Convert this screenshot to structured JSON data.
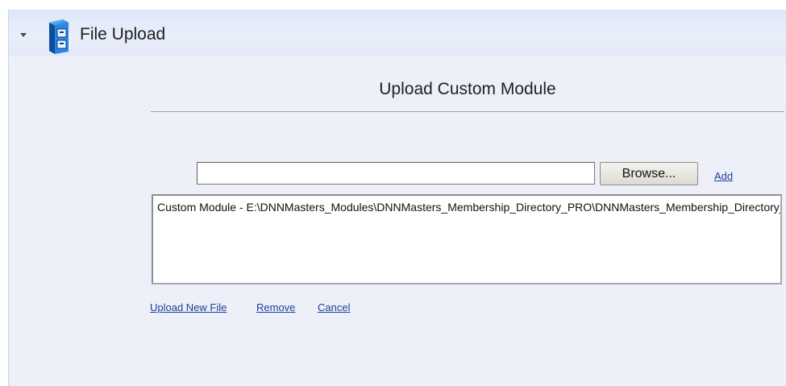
{
  "module": {
    "title": "File Upload",
    "icon": "file-cabinet-icon",
    "collapse_icon": "collapse-arrow-icon"
  },
  "page": {
    "heading": "Upload Custom Module"
  },
  "upload_form": {
    "file_input_value": "",
    "browse_label": "Browse...",
    "add_label": "Add"
  },
  "file_list": {
    "items": [
      "Custom Module - E:\\DNNMasters_Modules\\DNNMasters_Membership_Directory_PRO\\DNNMasters_Membership_Directory_PRO"
    ]
  },
  "actions": {
    "upload_new_file": "Upload New File",
    "remove": "Remove",
    "cancel": "Cancel"
  },
  "colors": {
    "panel_background": "#edf0f8",
    "titlebar_gradient_top": "#dde7f8",
    "link": "#1b3f9a"
  }
}
